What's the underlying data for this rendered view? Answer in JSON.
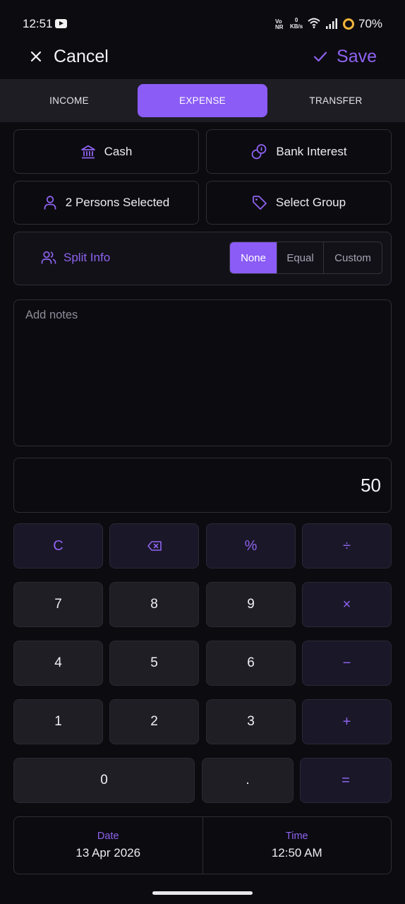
{
  "status_bar": {
    "time": "12:51",
    "volte": "Vo NR",
    "net_speed": "0",
    "net_unit": "KB/s",
    "battery": "70%"
  },
  "header": {
    "cancel_label": "Cancel",
    "save_label": "Save"
  },
  "tabs": [
    {
      "label": "INCOME",
      "active": false
    },
    {
      "label": "EXPENSE",
      "active": true
    },
    {
      "label": "TRANSFER",
      "active": false
    }
  ],
  "form": {
    "account": "Cash",
    "category": "Bank Interest",
    "persons": "2 Persons Selected",
    "group": "Select Group",
    "split_label": "Split Info",
    "split_options": [
      "None",
      "Equal",
      "Custom"
    ],
    "split_selected": "None",
    "notes_placeholder": "Add notes",
    "amount": "50"
  },
  "keypad": {
    "clear": "C",
    "percent": "%",
    "divide": "÷",
    "multiply": "×",
    "minus": "−",
    "plus": "+",
    "equals": "=",
    "dot": ".",
    "digits": [
      "0",
      "1",
      "2",
      "3",
      "4",
      "5",
      "6",
      "7",
      "8",
      "9"
    ]
  },
  "datetime": {
    "date_label": "Date",
    "date_value": "13 Apr 2026",
    "time_label": "Time",
    "time_value": "12:50 AM"
  },
  "colors": {
    "accent": "#8b5cf6",
    "background": "#0c0b10",
    "key": "#1f1e25",
    "operator_key": "#1a1728"
  }
}
